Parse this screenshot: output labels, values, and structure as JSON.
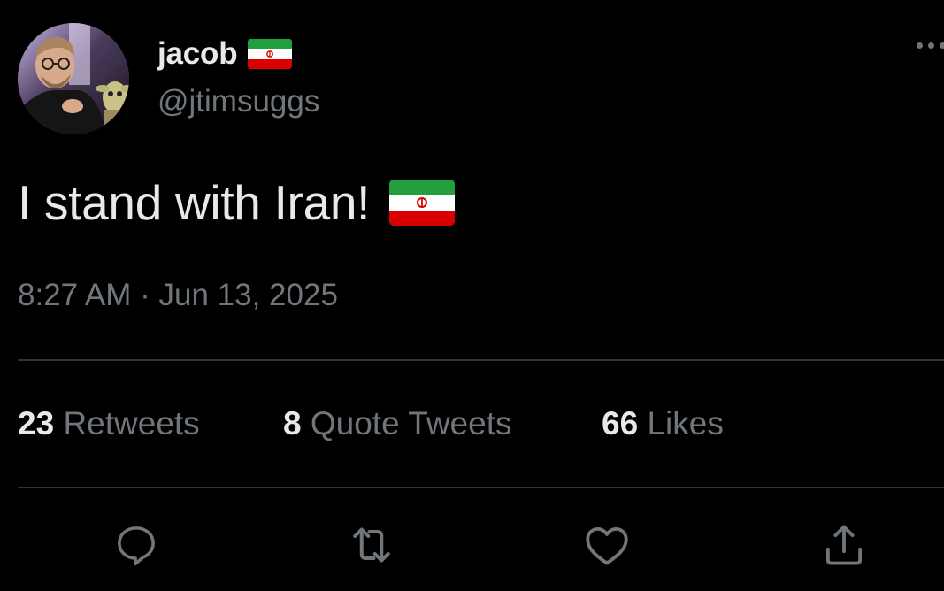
{
  "tweet": {
    "author": {
      "display_name": "jacob",
      "handle": "@jtimsuggs",
      "flag_icon": "iran-flag-icon"
    },
    "text": "I stand with Iran!",
    "text_emoji": "iran-flag-icon",
    "timestamp": "8:27 AM · Jun 13, 2025"
  },
  "stats": {
    "retweets_count": "23",
    "retweets_label": "Retweets",
    "quotes_count": "8",
    "quotes_label": "Quote Tweets",
    "likes_count": "66",
    "likes_label": "Likes"
  },
  "actions": [
    "reply-icon",
    "retweet-icon",
    "like-icon",
    "share-icon"
  ],
  "colors": {
    "background": "#000000",
    "primary_text": "#e7e9ea",
    "secondary_text": "#71767b",
    "divider": "#2f3336"
  }
}
